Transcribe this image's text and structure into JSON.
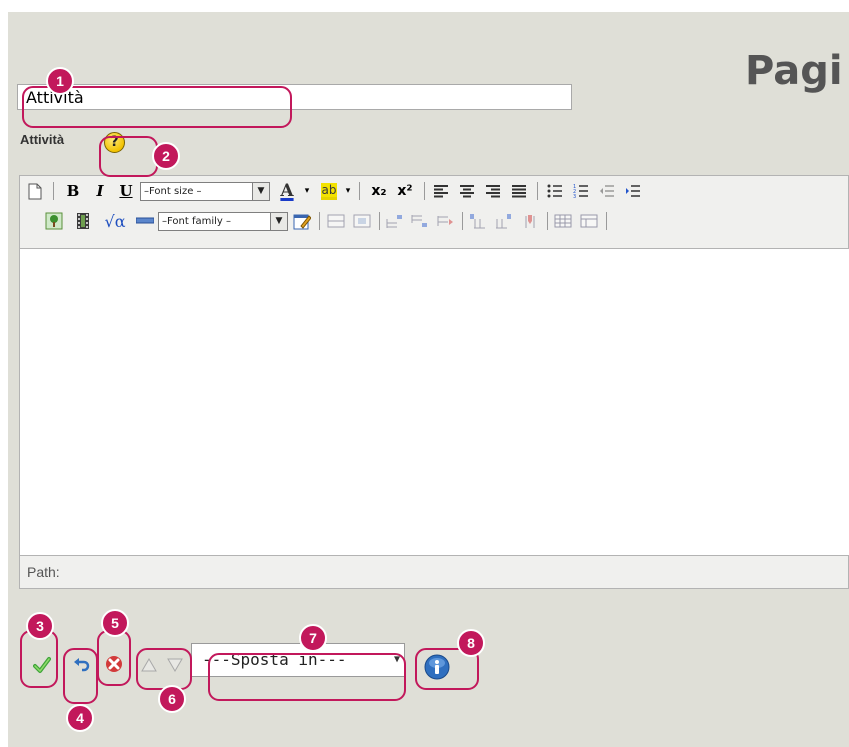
{
  "header": {
    "title": "Pagi"
  },
  "title_field": {
    "value": "Attività"
  },
  "field_label": "Attività",
  "help": {
    "glyph": "?"
  },
  "toolbar": {
    "bold": "B",
    "italic": "I",
    "underline": "U",
    "font_size": "–Font size –",
    "font_family": "–Font family –",
    "font_color_glyph": "A",
    "highlight_glyph": "ab",
    "subscript": "x₂",
    "superscript": "x²",
    "math_glyph": "√α"
  },
  "editor": {
    "content": "",
    "path_label": "Path:"
  },
  "actions": {
    "move_select": "---Sposta in---"
  },
  "callouts": [
    "1",
    "2",
    "3",
    "4",
    "5",
    "6",
    "7",
    "8"
  ],
  "colors": {
    "accent": "#c2185b",
    "background": "#dfdfd7",
    "confirm": "#3fa43a",
    "delete": "#d23a3a",
    "info": "#2f6fbf"
  }
}
